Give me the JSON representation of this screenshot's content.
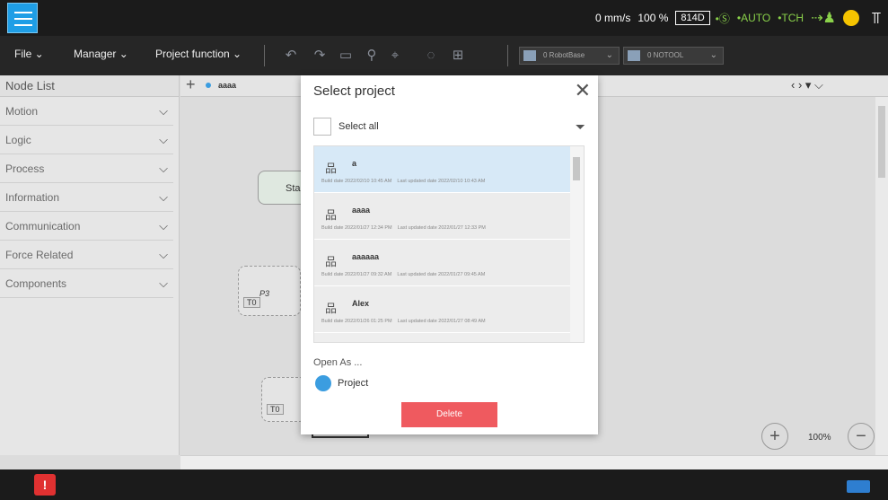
{
  "status": {
    "speed": "0 mm/s",
    "percent": "100 %",
    "code": "814D",
    "s_icon": "•Ⓢ",
    "auto": "•AUTO",
    "tch": "•TCH"
  },
  "toolbar": {
    "file": "File ⌄",
    "manager": "Manager ⌄",
    "project_function": "Project function ⌄",
    "robot_base": "0 RobotBase",
    "tool": "0 NOTOOL"
  },
  "sidebar": {
    "title": "Node List",
    "items": [
      {
        "label": "Motion"
      },
      {
        "label": "Logic"
      },
      {
        "label": "Process"
      },
      {
        "label": "Information"
      },
      {
        "label": "Communication"
      },
      {
        "label": "Force Related"
      },
      {
        "label": "Components"
      }
    ]
  },
  "canvas": {
    "tab_label": "aaaa",
    "node_start": "Sta",
    "node_t0": "T0",
    "node_p3": "P3",
    "node_t0b": "T0",
    "zoom": "100%"
  },
  "dialog": {
    "title": "Select project",
    "select_all": "Select all",
    "projects": [
      {
        "name": "a",
        "build": "Build date  2022/02/10 10:45 AM",
        "updated": "Last updated date  2022/02/10 10:43 AM"
      },
      {
        "name": "aaaa",
        "build": "Build date  2022/01/27 12:34 PM",
        "updated": "Last updated date  2022/01/27 12:33 PM"
      },
      {
        "name": "aaaaaa",
        "build": "Build date  2022/01/27 09:32 AM",
        "updated": "Last updated date  2022/01/27 09:45 AM"
      },
      {
        "name": "Alex",
        "build": "Build date  2022/01/26 01:25 PM",
        "updated": "Last updated date  2022/01/27 08:49 AM"
      }
    ],
    "open_as": "Open As ...",
    "radio_label": "Project",
    "delete": "Delete"
  },
  "colors": {
    "accent": "#1f9ee6",
    "delete": "#ef5a5f",
    "selected_row": "#d7e9f7"
  },
  "icons": [
    "menu-icon",
    "close-icon",
    "filter-icon",
    "project-icon",
    "warning-icon",
    "keyboard-icon"
  ]
}
